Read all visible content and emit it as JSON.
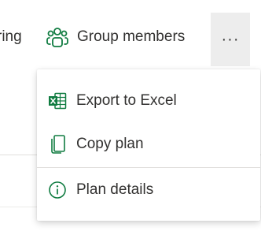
{
  "toolbar": {
    "truncated_label": "ring",
    "group_members_label": "Group members",
    "more_label": "···"
  },
  "menu": {
    "items": [
      {
        "label": "Export to Excel",
        "icon": "excel-icon"
      },
      {
        "label": "Copy plan",
        "icon": "copy-icon"
      },
      {
        "label": "Plan details",
        "icon": "info-icon"
      }
    ]
  },
  "colors": {
    "accent_green": "#107c41",
    "text": "#323130",
    "more_button_bg": "#ededed"
  }
}
